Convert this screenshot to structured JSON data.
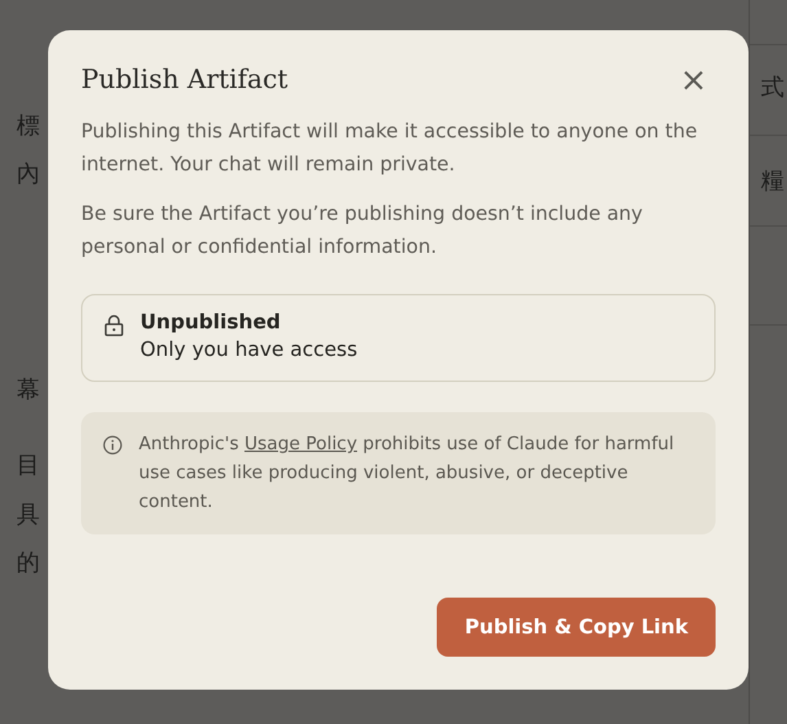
{
  "background": {
    "left_items": [
      "標",
      "內",
      "幕",
      "目",
      "具",
      "的"
    ],
    "right_items": [
      "式",
      "糧"
    ]
  },
  "dialog": {
    "title": "Publish Artifact",
    "close": "×",
    "paragraphs": [
      "Publishing this Artifact will make it accessible to anyone on the internet. Your chat will remain private.",
      "Be sure the Artifact you’re publishing doesn’t include any personal or confidential information."
    ],
    "status": {
      "title": "Unpublished",
      "detail": "Only you have access"
    },
    "notice": {
      "before": "Anthropic's ",
      "link": "Usage Policy",
      "after": " prohibits use of Claude for harmful use cases like producing violent, abusive, or deceptive content."
    },
    "button": "Publish & Copy Link"
  }
}
